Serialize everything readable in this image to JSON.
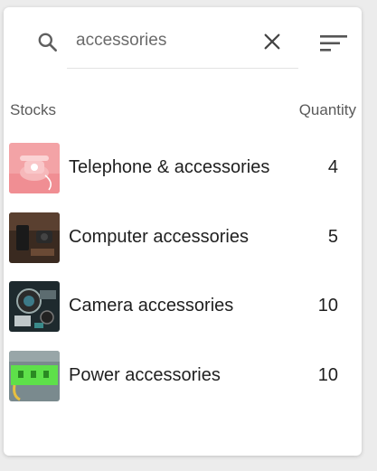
{
  "search": {
    "value": "accessories",
    "icon": "search-icon",
    "clear_icon": "close-icon",
    "sort_icon": "sort-icon"
  },
  "table": {
    "headers": {
      "stocks": "Stocks",
      "quantity": "Quantity"
    },
    "rows": [
      {
        "name": "Telephone & accessories",
        "quantity": "4",
        "thumbnail": "telephone-thumbnail"
      },
      {
        "name": "Computer accessories",
        "quantity": "5",
        "thumbnail": "computer-thumbnail"
      },
      {
        "name": "Camera accessories",
        "quantity": "10",
        "thumbnail": "camera-thumbnail"
      },
      {
        "name": "Power accessories",
        "quantity": "10",
        "thumbnail": "power-thumbnail"
      }
    ]
  },
  "colors": {
    "card_bg": "#ffffff",
    "page_bg": "#ececec",
    "text_primary": "#1f1f1f",
    "text_secondary": "#5a5a5a"
  }
}
